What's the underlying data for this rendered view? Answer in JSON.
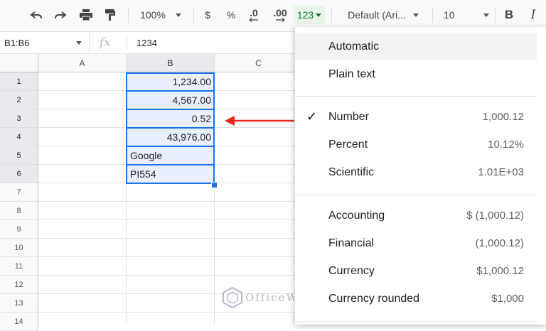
{
  "toolbar": {
    "zoom": "100%",
    "currency": "$",
    "percent": "%",
    "dec_decrease": ".0",
    "dec_increase": ".00",
    "more_formats": "123",
    "font": "Default (Ari...",
    "font_size": "10",
    "bold": "B",
    "italic": "I"
  },
  "formula_bar": {
    "name_box": "B1:B6",
    "fx": "fx",
    "value": "1234"
  },
  "columns": [
    "A",
    "B",
    "C"
  ],
  "rows": [
    "1",
    "2",
    "3",
    "4",
    "5",
    "6",
    "7",
    "8",
    "9",
    "10",
    "11",
    "12",
    "13",
    "14"
  ],
  "cells_b": [
    "1,234.00",
    "4,567.00",
    "0.52",
    "43,976.00",
    "Google",
    "PI554"
  ],
  "menu": {
    "automatic": "Automatic",
    "plain_text": "Plain text",
    "number": {
      "label": "Number",
      "example": "1,000.12",
      "checked": "✓"
    },
    "percent": {
      "label": "Percent",
      "example": "10.12%"
    },
    "scientific": {
      "label": "Scientific",
      "example": "1.01E+03"
    },
    "accounting": {
      "label": "Accounting",
      "example": "$ (1,000.12)"
    },
    "financial": {
      "label": "Financial",
      "example": "(1,000.12)"
    },
    "currency": {
      "label": "Currency",
      "example": "$1,000.12"
    },
    "currency_rounded": {
      "label": "Currency rounded",
      "example": "$1,000"
    }
  },
  "watermark": "OfficeWheel",
  "colors": {
    "selection": "#1a73e8",
    "arrow": "#e8271f",
    "menu_highlight": "#f1f3f4",
    "more_formats_bg": "#e6f4ea"
  }
}
